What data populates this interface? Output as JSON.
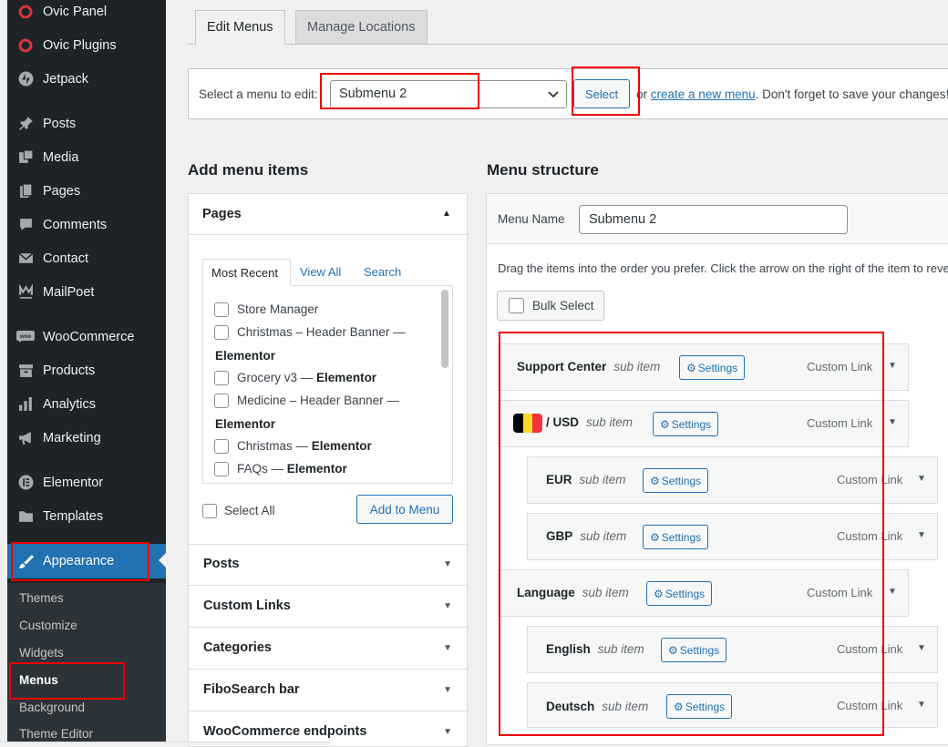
{
  "sidebar": {
    "items": [
      {
        "label": "Ovic Panel",
        "icon": "ovic-icon"
      },
      {
        "label": "Ovic Plugins",
        "icon": "ovic-icon"
      },
      {
        "label": "Jetpack",
        "icon": "jetpack-icon"
      },
      {
        "label": "Posts",
        "icon": "pin-icon"
      },
      {
        "label": "Media",
        "icon": "media-icon"
      },
      {
        "label": "Pages",
        "icon": "pages-icon"
      },
      {
        "label": "Comments",
        "icon": "comment-icon"
      },
      {
        "label": "Contact",
        "icon": "mail-icon"
      },
      {
        "label": "MailPoet",
        "icon": "mailpoet-icon"
      },
      {
        "label": "WooCommerce",
        "icon": "woo-icon"
      },
      {
        "label": "Products",
        "icon": "archive-icon"
      },
      {
        "label": "Analytics",
        "icon": "chart-icon"
      },
      {
        "label": "Marketing",
        "icon": "megaphone-icon"
      },
      {
        "label": "Elementor",
        "icon": "elementor-icon"
      },
      {
        "label": "Templates",
        "icon": "folder-icon"
      },
      {
        "label": "Appearance",
        "icon": "brush-icon"
      }
    ],
    "submenu": [
      "Themes",
      "Customize",
      "Widgets",
      "Menus",
      "Background",
      "Theme Editor"
    ]
  },
  "tabs": {
    "edit": "Edit Menus",
    "manage": "Manage Locations"
  },
  "select_menu": {
    "label": "Select a menu to edit:",
    "value": "Submenu 2",
    "button": "Select",
    "or_text": "or",
    "create_link": "create a new menu",
    "after": ". Don't forget to save your changes!"
  },
  "add_items": {
    "heading": "Add menu items",
    "pages": {
      "title": "Pages",
      "tabs": [
        "Most Recent",
        "View All",
        "Search"
      ],
      "rows": [
        {
          "text": "Store Manager",
          "suffix": ""
        },
        {
          "text": "Christmas – Header Banner —",
          "suffix": "Elementor"
        },
        {
          "text": "Grocery v3 —",
          "suffix": "Elementor"
        },
        {
          "text": "Medicine – Header Banner —",
          "suffix": "Elementor"
        },
        {
          "text": "Christmas —",
          "suffix": "Elementor"
        },
        {
          "text": "FAQs —",
          "suffix": "Elementor"
        }
      ],
      "select_all": "Select All",
      "add_button": "Add to Menu"
    },
    "sections": [
      "Posts",
      "Custom Links",
      "Categories",
      "FiboSearch bar",
      "WooCommerce endpoints"
    ]
  },
  "structure": {
    "heading": "Menu structure",
    "name_label": "Menu Name",
    "name_value": "Submenu 2",
    "instructions": "Drag the items into the order you prefer. Click the arrow on the right of the item to reveal additional configuration options.",
    "bulk_select": "Bulk Select",
    "sub_label": "sub item",
    "settings_label": "Settings",
    "type_label": "Custom Link",
    "items": [
      {
        "title": "Support Center"
      },
      {
        "title": "/ USD",
        "flag": [
          "#000000",
          "#fdda24",
          "#ef3340"
        ]
      },
      {
        "title": "EUR"
      },
      {
        "title": "GBP"
      },
      {
        "title": "Language"
      },
      {
        "title": "English"
      },
      {
        "title": "Deutsch"
      }
    ]
  }
}
